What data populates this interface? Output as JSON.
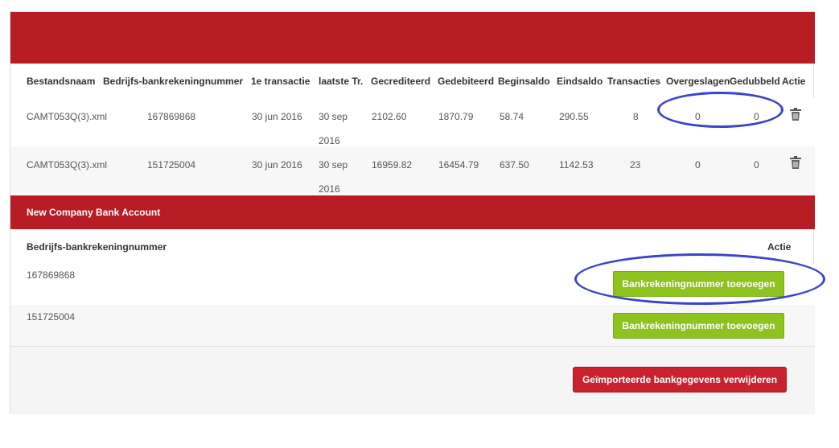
{
  "colors": {
    "brand_red": "#b81c25",
    "action_green": "#8dc21f",
    "danger_red": "#c9222d",
    "annotation_blue": "#3a44c8"
  },
  "import_table": {
    "headers": [
      "Bestandsnaam",
      "Bedrijfs-bankrekeningnummer",
      "1e transactie",
      "laatste Tr.",
      "Gecrediteerd",
      "Gedebiteerd",
      "Beginsaldo",
      "Eindsaldo",
      "Transacties",
      "Overgeslagen",
      "Gedubbeld",
      "Actie"
    ],
    "rows": [
      {
        "file": "CAMT053Q(3).xml",
        "account": "167869868",
        "first": "30 jun 2016",
        "last": "30 sep 2016",
        "credited": "2102.60",
        "debited": "1870.79",
        "begin": "58.74",
        "end": "290.55",
        "transactions": "8",
        "skipped": "0",
        "duplicated": "0",
        "action_icon": "trash-icon"
      },
      {
        "file": "CAMT053Q(3).xml",
        "account": "151725004",
        "first": "30 jun 2016",
        "last": "30 sep 2016",
        "credited": "16959.82",
        "debited": "16454.79",
        "begin": "637.50",
        "end": "1142.53",
        "transactions": "23",
        "skipped": "0",
        "duplicated": "0",
        "action_icon": "trash-icon"
      }
    ]
  },
  "new_account": {
    "title": "New Company Bank Account",
    "headers": [
      "Bedrijfs-bankrekeningnummer",
      "Actie"
    ],
    "rows": [
      {
        "account": "167869868",
        "button": "Bankrekeningnummer toevoegen"
      },
      {
        "account": "151725004",
        "button": "Bankrekeningnummer toevoegen"
      }
    ]
  },
  "footer": {
    "delete_button": "Geïmporteerde bankgegevens verwijderen"
  }
}
